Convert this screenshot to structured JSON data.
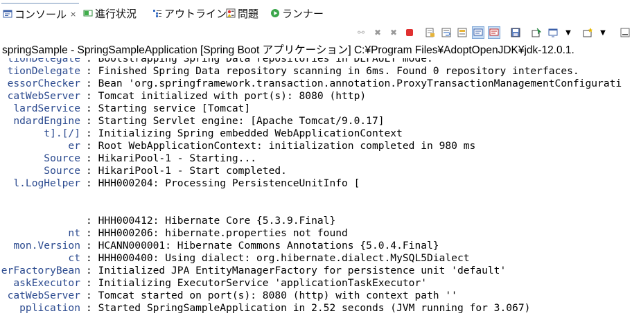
{
  "tabs": [
    {
      "label": "コンソール",
      "icon": "console-icon",
      "active": true,
      "close": "×"
    },
    {
      "label": "進行状況",
      "icon": "progress-icon"
    },
    {
      "label": "アウトライン",
      "icon": "outline-icon"
    },
    {
      "label": "問題",
      "icon": "problems-icon"
    },
    {
      "label": "ランナー",
      "icon": "run-icon"
    }
  ],
  "toolbar": {
    "icons": [
      "disconnect-icon",
      "terminate-icon",
      "remove-all-terminated-icon",
      "stop-icon",
      "scroll-lock-icon",
      "word-wrap-icon",
      "show-console-on-output-icon",
      "show-stdout-icon",
      "show-stderr-icon",
      "save-icon",
      "pin-console-icon",
      "display-console-icon",
      "dropdown-arrow-icon",
      "new-console-icon",
      "dropdown-arrow-icon",
      "minimize-icon"
    ]
  },
  "console": {
    "title": "springSample - SpringSampleApplication [Spring Boot アプリケーション] C:¥Program Files¥AdoptOpenJDK¥jdk-12.0.1.",
    "lines": [
      {
        "src": "tionDelegate",
        "msg": ": Bootstrapping Spring Data repositories in DEFAULT mode."
      },
      {
        "src": "tionDelegate",
        "msg": ": Finished Spring Data repository scanning in 6ms. Found 0 repository interfaces."
      },
      {
        "src": "essorChecker",
        "msg": ": Bean 'org.springframework.transaction.annotation.ProxyTransactionManagementConfigurati"
      },
      {
        "src": "catWebServer",
        "msg": ": Tomcat initialized with port(s): 8080 (http)"
      },
      {
        "src": "lardService",
        "msg": ": Starting service [Tomcat]"
      },
      {
        "src": "ndardEngine",
        "msg": ": Starting Servlet engine: [Apache Tomcat/9.0.17]"
      },
      {
        "src": "t].[/]",
        "msg": ": Initializing Spring embedded WebApplicationContext"
      },
      {
        "src": "er",
        "msg": ": Root WebApplicationContext: initialization completed in 980 ms"
      },
      {
        "src": "Source",
        "msg": ": HikariPool-1 - Starting..."
      },
      {
        "src": "Source",
        "msg": ": HikariPool-1 - Start completed."
      },
      {
        "src": "l.LogHelper",
        "msg": ": HHH000204: Processing PersistenceUnitInfo ["
      },
      {
        "src": "",
        "msg": ""
      },
      {
        "src": "",
        "msg": ""
      },
      {
        "src": "",
        "msg": ": HHH000412: Hibernate Core {5.3.9.Final}"
      },
      {
        "src": "nt",
        "msg": ": HHH000206: hibernate.properties not found"
      },
      {
        "src": "mon.Version",
        "msg": ": HCANN000001: Hibernate Commons Annotations {5.0.4.Final}"
      },
      {
        "src": "ct",
        "msg": ": HHH000400: Using dialect: org.hibernate.dialect.MySQL5Dialect"
      },
      {
        "src": "erFactoryBean",
        "msg": ": Initialized JPA EntityManagerFactory for persistence unit 'default'"
      },
      {
        "src": "askExecutor",
        "msg": ": Initializing ExecutorService 'applicationTaskExecutor'"
      },
      {
        "src": "catWebServer",
        "msg": ": Tomcat started on port(s): 8080 (http) with context path ''"
      },
      {
        "src": "pplication",
        "msg": ": Started SpringSampleApplication in 2.52 seconds (JVM running for 3.067)"
      }
    ]
  }
}
